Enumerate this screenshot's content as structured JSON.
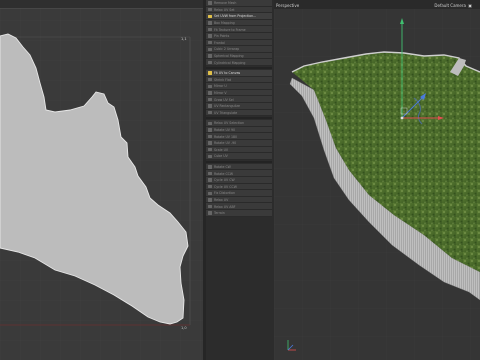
{
  "uv_editor": {
    "top_labels": [
      "",
      ""
    ],
    "corner_top": "1,1",
    "corner_bottom": "1,0"
  },
  "tool_panel": {
    "items": [
      {
        "label": "Remove Mesh",
        "highlight": false
      },
      {
        "label": "Relax UV Set",
        "highlight": false
      },
      {
        "label": "Set UVW from Projection...",
        "highlight": true
      },
      {
        "label": "Box Mapping",
        "highlight": false
      },
      {
        "label": "Fit Texture to Frame",
        "highlight": false
      },
      {
        "label": "Pin Points",
        "highlight": false
      },
      {
        "label": "Frontal",
        "highlight": false
      },
      {
        "label": "Cubic 2 Unwrap",
        "highlight": false
      },
      {
        "label": "Spherical Mapping",
        "highlight": false
      },
      {
        "label": "Cylindrical Mapping",
        "highlight": false
      },
      {
        "label": "Fit UV to Canvas",
        "highlight": true
      },
      {
        "label": "Shrink Flat",
        "highlight": false
      },
      {
        "label": "Mirror U",
        "highlight": false
      },
      {
        "label": "Mirror V",
        "highlight": false
      },
      {
        "label": "Grow UV Sel",
        "highlight": false
      },
      {
        "label": "UV Rectangulize",
        "highlight": false
      },
      {
        "label": "UV Triangulate",
        "highlight": false
      },
      {
        "label": "Relax UV Selection",
        "highlight": false
      },
      {
        "label": "Rotate UV 90",
        "highlight": false
      },
      {
        "label": "Rotate UV 180",
        "highlight": false
      },
      {
        "label": "Rotate UV -90",
        "highlight": false
      },
      {
        "label": "Scale UV",
        "highlight": false
      },
      {
        "label": "Cube UV",
        "highlight": false
      },
      {
        "label": "Rotate CW",
        "highlight": false
      },
      {
        "label": "Rotate CCW",
        "highlight": false
      },
      {
        "label": "Cycle UV CW",
        "highlight": false
      },
      {
        "label": "Cycle UV CCW",
        "highlight": false
      },
      {
        "label": "Fix Distortion",
        "highlight": false
      },
      {
        "label": "Relax UV",
        "highlight": false
      },
      {
        "label": "Relax UV ABF",
        "highlight": false
      },
      {
        "label": "Terrain",
        "highlight": false
      }
    ]
  },
  "viewport": {
    "title": "Perspective",
    "camera": "Default Camera",
    "camera_icon": "camera-icon",
    "colors": {
      "terrain_green": "#4d6b2a",
      "terrain_cliff": "#b8b8b8",
      "axis_x": "#e05050",
      "axis_y": "#40c070",
      "axis_z": "#4a7ae0"
    }
  }
}
